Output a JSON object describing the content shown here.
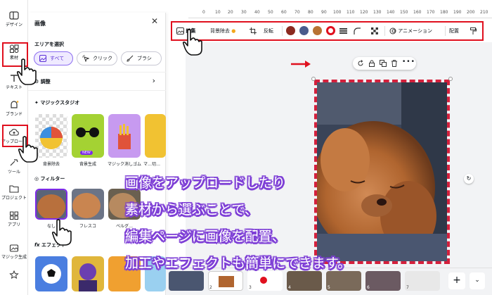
{
  "rail": {
    "items": [
      {
        "label": "デザイン",
        "icon": "layout-icon"
      },
      {
        "label": "素材",
        "icon": "elements-icon"
      },
      {
        "label": "テキスト",
        "icon": "text-icon"
      },
      {
        "label": "ブランド",
        "icon": "brand-icon"
      },
      {
        "label": "アップロード",
        "icon": "upload-icon"
      },
      {
        "label": "ツール",
        "icon": "tools-icon"
      },
      {
        "label": "プロジェクト",
        "icon": "folder-icon"
      },
      {
        "label": "アプリ",
        "icon": "apps-icon"
      },
      {
        "label": "マジック生成",
        "icon": "magic-media-icon"
      }
    ]
  },
  "panel": {
    "title": "画像",
    "select_area": "エリアを選択",
    "chips": [
      {
        "label": "すべて",
        "active": true
      },
      {
        "label": "クリック",
        "active": false
      },
      {
        "label": "ブラシ",
        "active": false
      }
    ],
    "adjust": "調整",
    "magic_studio": "マジックスタジオ",
    "magic_items": [
      {
        "label": "背景除去"
      },
      {
        "label": "背景生成",
        "badge": "NEW"
      },
      {
        "label": "マジック消しゴム"
      },
      {
        "label": "マ…切…"
      }
    ],
    "filter": "フィルター",
    "filter_items": [
      "なし",
      "フレスコ",
      "ベルグ…"
    ],
    "effect": "エフェクト"
  },
  "ruler": {
    "ticks": [
      "0",
      "10",
      "20",
      "30",
      "40",
      "50",
      "60",
      "70",
      "80",
      "90",
      "100",
      "110",
      "120",
      "130",
      "140",
      "150",
      "160",
      "170",
      "180",
      "190",
      "200",
      "210"
    ]
  },
  "toolbar": {
    "edit_label": "編集",
    "bg_remove": "背景除去",
    "flip": "反転",
    "animate": "アニメーション",
    "position": "配置",
    "swatch_colors": [
      "#8b2a1f",
      "#4a5b8c",
      "#b87333",
      "#e0101e"
    ]
  },
  "pages": {
    "numbers": [
      "2",
      "3",
      "4",
      "5",
      "6",
      "7"
    ]
  },
  "caption": {
    "lines": [
      "画像をアップロードしたり",
      "素材から選ぶことで、",
      "編集ページに画像を配置、",
      "加工やエフェクトも簡単にできます。"
    ]
  },
  "colors": {
    "accent_red": "#e0101e",
    "caption_outline": "#7e3fd6",
    "chip_active": "#8b6cf0"
  }
}
